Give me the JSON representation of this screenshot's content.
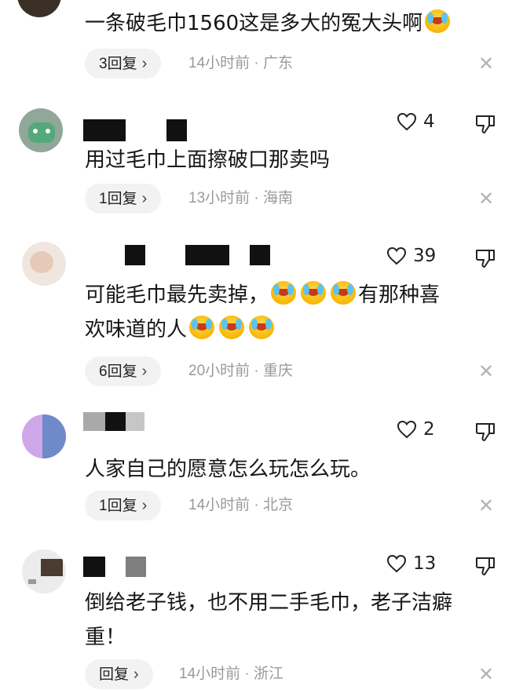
{
  "comments": [
    {
      "text_lines": [
        "一条破毛巾1560这是多大的冤大头啊"
      ],
      "emoji_after": 1,
      "replies": "3回复",
      "meta": "14小时前 · 广东",
      "likes": null
    },
    {
      "text_lines": [
        "用过毛巾上面擦破口那卖吗"
      ],
      "replies": "1回复",
      "meta": "13小时前 · 海南",
      "likes": "4"
    },
    {
      "line1_a": "可能毛巾最先卖掉，",
      "line1_b": "有那种喜",
      "line2": "欢味道的人",
      "replies": "6回复",
      "meta": "20小时前 · 重庆",
      "likes": "39"
    },
    {
      "text_lines": [
        "人家自己的愿意怎么玩怎么玩。"
      ],
      "replies": "1回复",
      "meta": "14小时前 · 北京",
      "likes": "2"
    },
    {
      "text_lines": [
        "倒给老子钱，也不用二手毛巾，老子洁癖",
        "重！"
      ],
      "replies": "回复",
      "meta": "14小时前 · 浙江",
      "likes": "13"
    }
  ],
  "icons": {
    "like": "heart-outline-icon",
    "dislike": "thumbs-down-outline-icon",
    "close": "close-icon",
    "emoji": "laughing-crying-emoji"
  },
  "colors": {
    "text": "#161616",
    "meta": "#9a9a9a",
    "pill": "#f2f2f2",
    "emoji": "#f7b400"
  }
}
